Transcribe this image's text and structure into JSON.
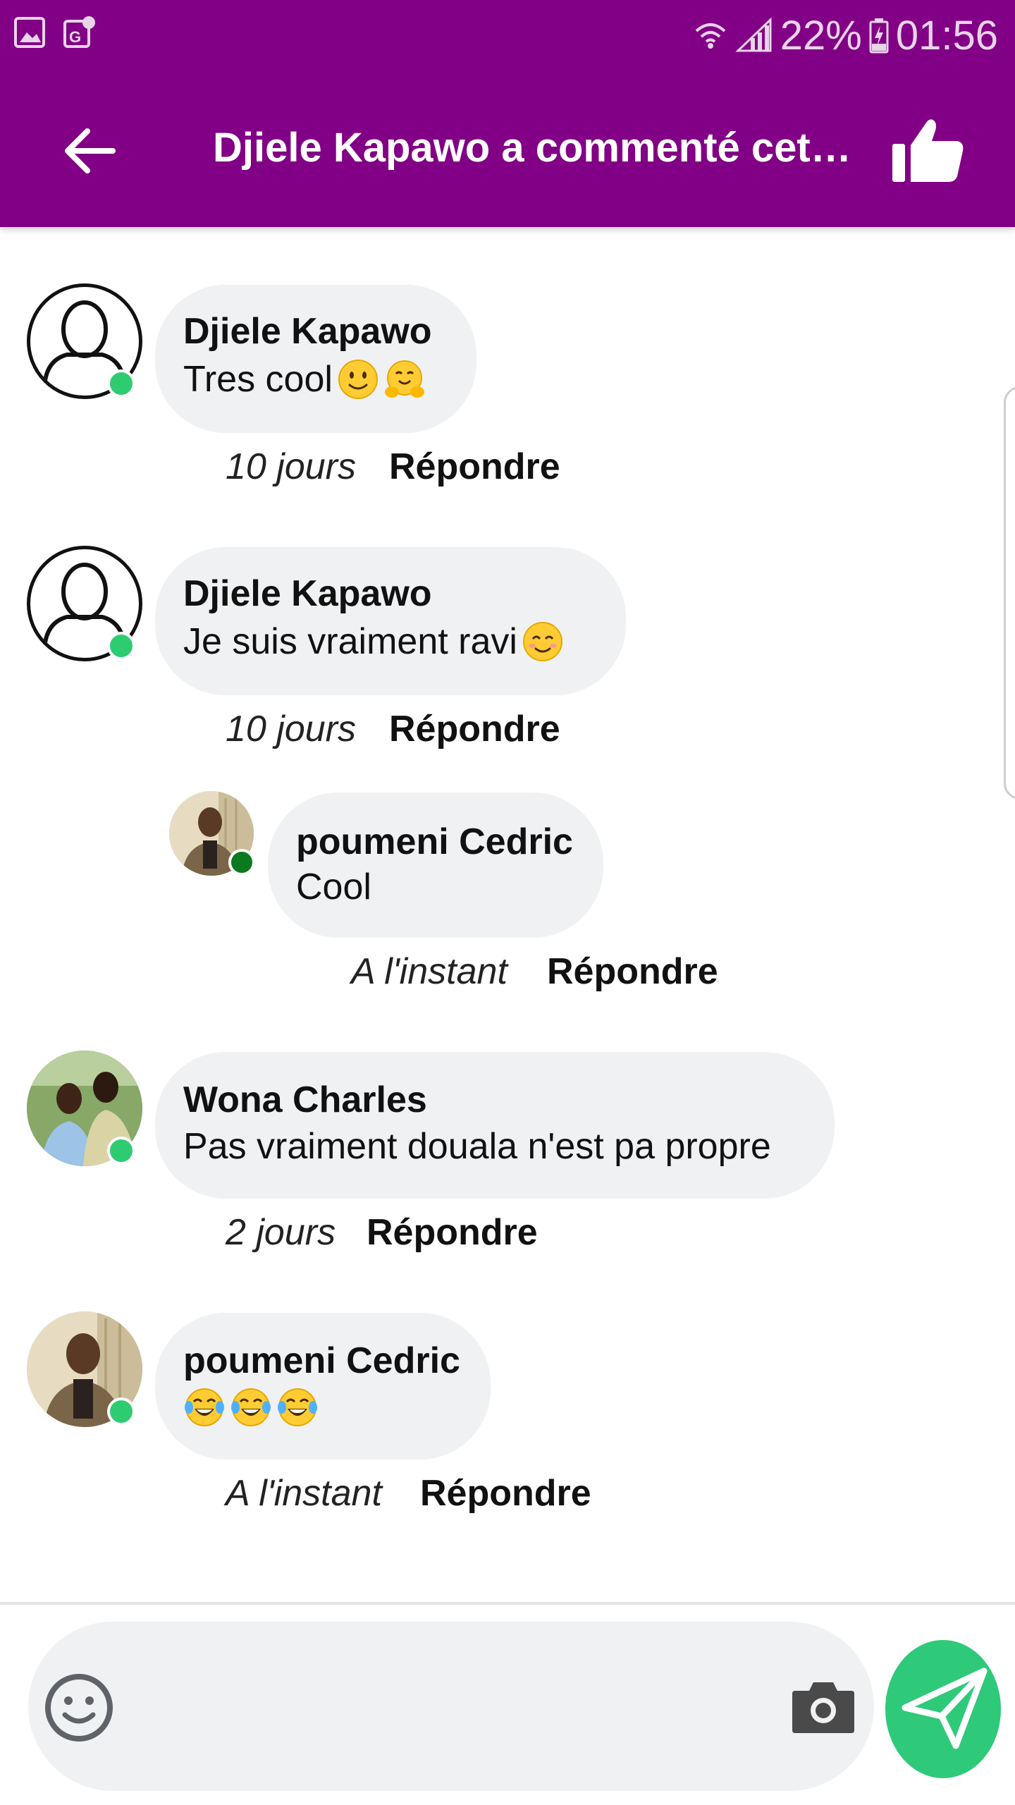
{
  "status_bar": {
    "battery": "22%",
    "time": "01:56"
  },
  "app_bar": {
    "title": "Djiele Kapawo a commenté cet…"
  },
  "comments": [
    {
      "author": "Djiele Kapawo",
      "text": "Tres cool",
      "emojis": [
        "slightly-smiling-face",
        "hugging-face"
      ],
      "time": "10 jours",
      "reply_label": "Répondre"
    },
    {
      "author": "Djiele Kapawo",
      "text": "Je suis vraiment ravi",
      "emojis": [
        "smiling-face-with-smiling-eyes"
      ],
      "time": "10 jours",
      "reply_label": "Répondre"
    },
    {
      "author": "poumeni Cedric",
      "text": "Cool",
      "emojis": [],
      "time": "A l'instant",
      "reply_label": "Répondre"
    },
    {
      "author": "Wona Charles",
      "text": "Pas vraiment douala n'est pa propre",
      "emojis": [],
      "time": "2 jours",
      "reply_label": "Répondre"
    },
    {
      "author": "poumeni Cedric",
      "text": "",
      "emojis": [
        "tears-of-joy",
        "tears-of-joy",
        "tears-of-joy"
      ],
      "time": "A l'instant",
      "reply_label": "Répondre"
    }
  ],
  "colors": {
    "app_bar": "#820085",
    "bubble": "#f0f1f3",
    "online_dot": "#2ecc71",
    "online_dot_dark": "#0b7a1e",
    "send_button": "#2fc97a"
  }
}
